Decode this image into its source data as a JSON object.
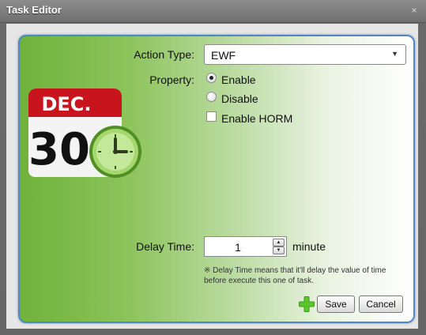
{
  "window": {
    "title": "Task Editor",
    "close_glyph": "×"
  },
  "calendar": {
    "month": "DEC.",
    "day": "30",
    "icon": "calendar-clock-icon"
  },
  "form": {
    "action_type": {
      "label": "Action Type:",
      "value": "EWF",
      "arrow": "▼"
    },
    "property": {
      "label": "Property:",
      "options": [
        {
          "label": "Enable",
          "selected": true
        },
        {
          "label": "Disable",
          "selected": false
        }
      ],
      "checkbox": {
        "label": "Enable HORM",
        "checked": false
      }
    },
    "delay": {
      "label": "Delay Time:",
      "value": "1",
      "unit": "minute",
      "note": "※ Delay Time means  that it'll delay the value of time before execute this one of task."
    }
  },
  "buttons": {
    "add_icon": "plus-icon",
    "save": "Save",
    "cancel": "Cancel"
  },
  "colors": {
    "panel_border": "#4d86c9",
    "panel_green": "#6fb23a",
    "calendar_red": "#c8151d",
    "clock_green": "#7cc04a"
  }
}
